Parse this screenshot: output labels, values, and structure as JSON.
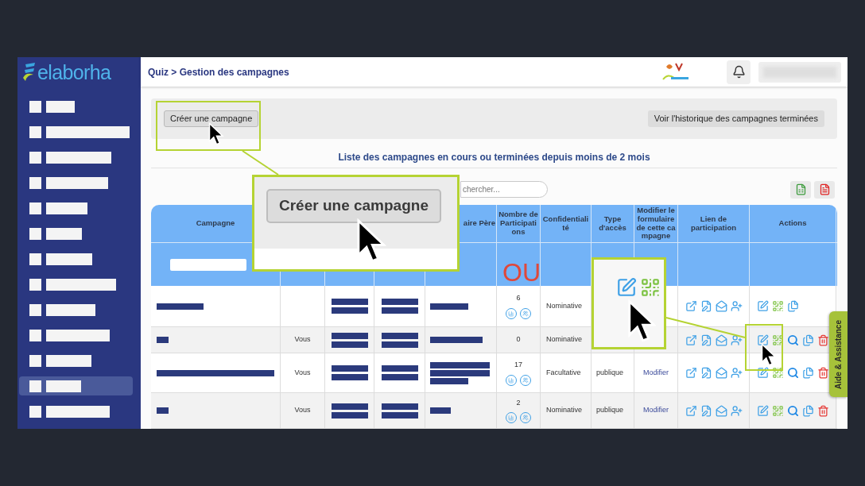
{
  "sidebar": {
    "logo": "elaborha",
    "items": [
      {
        "selected": false
      },
      {
        "selected": false
      },
      {
        "selected": false
      },
      {
        "selected": false
      },
      {
        "selected": false
      },
      {
        "selected": false
      },
      {
        "selected": false
      },
      {
        "selected": false
      },
      {
        "selected": false
      },
      {
        "selected": false
      },
      {
        "selected": false
      },
      {
        "selected": true
      },
      {
        "selected": false
      }
    ]
  },
  "header": {
    "breadcrumb": "Quiz > Gestion des campagnes"
  },
  "toolbar": {
    "create_button": "Créer une campagne",
    "history_button": "Voir l'historique des campagnes terminées"
  },
  "list_title": "Liste des campagnes en cours ou terminées depuis moins de 2 mois",
  "search": {
    "placeholder": "chercher..."
  },
  "table": {
    "headers": {
      "campaign": "Campagne",
      "parent": "aire Père",
      "participants": "Nombre de Participati ons",
      "confidentiality": "Confidentiali té",
      "access": "Type d'accès",
      "modify": "Modifier le formulaire de cette ca mpagne",
      "link": "Lien de participation",
      "actions": "Actions"
    },
    "rows": [
      {
        "participants": "6",
        "stats_icons": true,
        "confidentiality": "Nominative",
        "actions": [
          {
            "kind": "edit"
          },
          {
            "kind": "qr"
          },
          {
            "kind": "copy"
          }
        ]
      },
      {
        "owner": "Vous",
        "participants": "0",
        "stats_icons": false,
        "confidentiality": "Nominative",
        "actions": [
          {
            "kind": "edit"
          },
          {
            "kind": "qr"
          },
          {
            "kind": "search"
          },
          {
            "kind": "copy"
          },
          {
            "kind": "delete"
          }
        ]
      },
      {
        "owner": "Vous",
        "participants": "17",
        "stats_icons": true,
        "confidentiality": "Facultative",
        "access": "publique",
        "modify_link": "Modifier",
        "actions": [
          {
            "kind": "edit"
          },
          {
            "kind": "qr"
          },
          {
            "kind": "search"
          },
          {
            "kind": "copy"
          },
          {
            "kind": "delete"
          }
        ]
      },
      {
        "owner": "Vous",
        "participants": "2",
        "stats_icons": true,
        "confidentiality": "Nominative",
        "access": "publique",
        "modify_link": "Modifier",
        "actions": [
          {
            "kind": "edit"
          },
          {
            "kind": "qr"
          },
          {
            "kind": "search"
          },
          {
            "kind": "copy"
          },
          {
            "kind": "delete"
          }
        ]
      }
    ]
  },
  "callouts": [
    {
      "kind": "button_zoom",
      "label": "Créer une campagne"
    },
    {
      "kind": "icon_zoom"
    }
  ],
  "annotation": "OU",
  "help_tab": "Aide & Assistance"
}
